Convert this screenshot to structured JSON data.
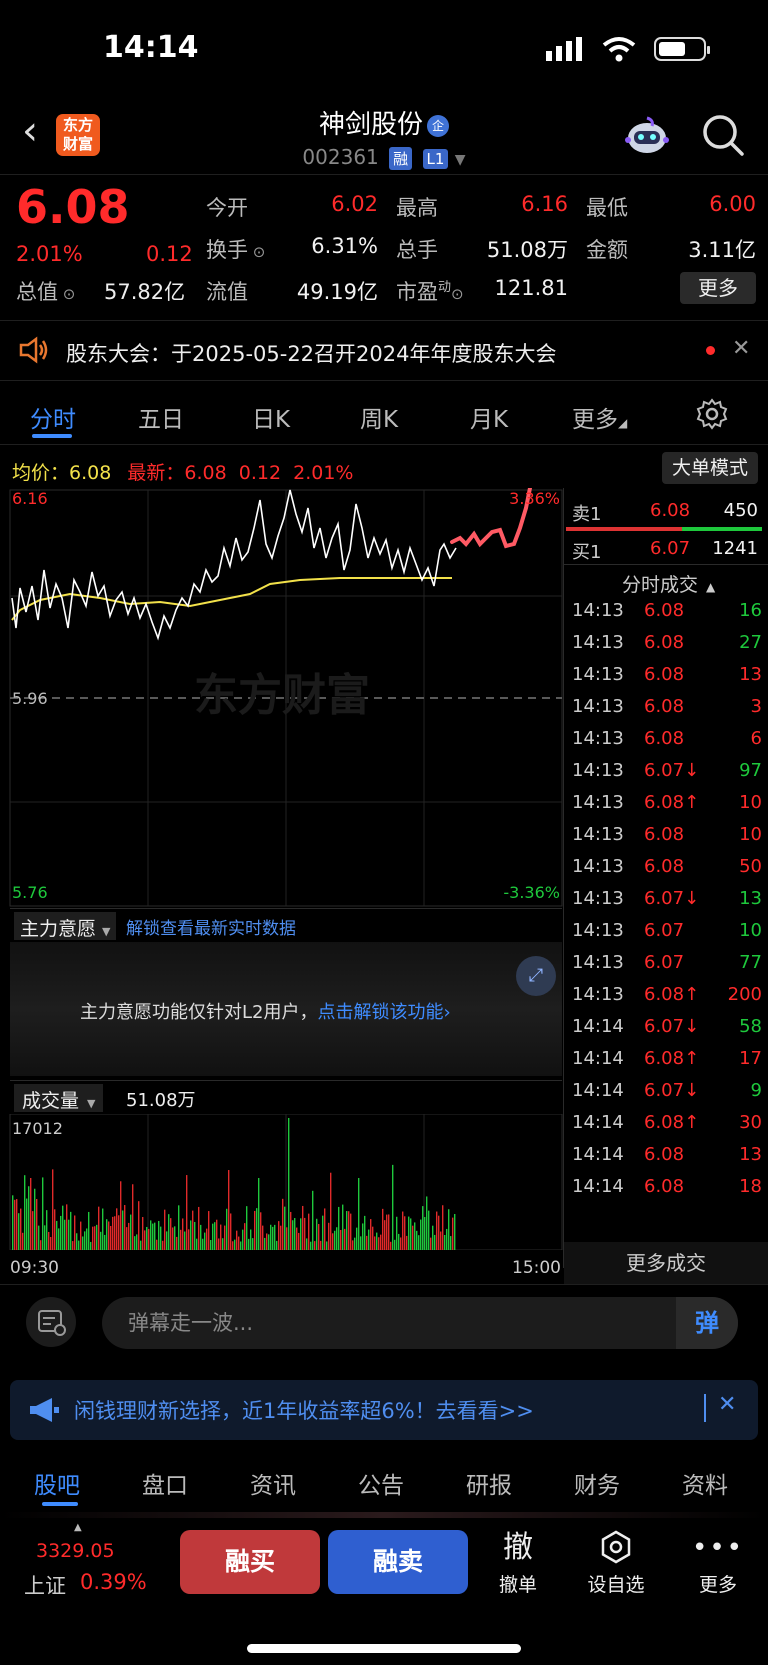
{
  "status_bar": {
    "time": "14:14"
  },
  "header": {
    "logo_line1": "东方",
    "logo_line2": "财富",
    "stock_name": "神剑股份",
    "cert_badge": "企",
    "stock_code": "002361",
    "tag1": "融",
    "tag2": "L1"
  },
  "quote": {
    "price": "6.08",
    "pct": "2.01%",
    "change": "0.12",
    "total_value_label": "总值",
    "total_value": "57.82亿",
    "open_label": "今开",
    "open": "6.02",
    "high_label": "最高",
    "high": "6.16",
    "low_label": "最低",
    "low": "6.00",
    "turnover_label": "换手",
    "turnover": "6.31%",
    "volume_label": "总手",
    "volume": "51.08万",
    "amount_label": "金额",
    "amount": "3.11亿",
    "float_label": "流值",
    "float_value": "49.19亿",
    "pe_label": "市盈",
    "pe_sup": "动",
    "pe": "121.81",
    "more_label": "更多"
  },
  "notice": {
    "text": "股东大会：于2025-05-22召开2024年年度股东大会"
  },
  "tabs": [
    "分时",
    "五日",
    "日K",
    "周K",
    "月K",
    "更多"
  ],
  "info_line": {
    "avg_label": "均价：",
    "avg": "6.08",
    "latest_label": "最新：",
    "latest": "6.08",
    "latest_change": "0.12",
    "latest_pct": "2.01%",
    "big_order_mode": "大单模式"
  },
  "chart_labels": {
    "top_price": "6.16",
    "mid_price": "5.96",
    "bottom_price": "5.76",
    "top_pct": "3.36%",
    "bottom_pct": "-3.36%",
    "watermark": "东方财富",
    "start_time": "09:30",
    "end_time": "15:00"
  },
  "main_force": {
    "label": "主力意愿",
    "unlock_link": "解锁查看最新实时数据",
    "message": "主力意愿功能仅针对L2用户，",
    "message_link": "点击解锁该功能"
  },
  "volume": {
    "label": "成交量",
    "total": "51.08万",
    "max": "17012"
  },
  "order_book": {
    "sell1_label": "卖1",
    "sell1_price": "6.08",
    "sell1_vol": "450",
    "buy1_label": "买1",
    "buy1_price": "6.07",
    "buy1_vol": "1241",
    "ticker_title": "分时成交",
    "more_trades": "更多成交"
  },
  "ticks": [
    {
      "time": "14:13",
      "price": "6.08",
      "arrow": "",
      "vol": "16",
      "side": "buy"
    },
    {
      "time": "14:13",
      "price": "6.08",
      "arrow": "",
      "vol": "27",
      "side": "buy"
    },
    {
      "time": "14:13",
      "price": "6.08",
      "arrow": "",
      "vol": "13",
      "side": "sell"
    },
    {
      "time": "14:13",
      "price": "6.08",
      "arrow": "",
      "vol": "3",
      "side": "sell"
    },
    {
      "time": "14:13",
      "price": "6.08",
      "arrow": "",
      "vol": "6",
      "side": "sell"
    },
    {
      "time": "14:13",
      "price": "6.07",
      "arrow": "↓",
      "vol": "97",
      "side": "buy"
    },
    {
      "time": "14:13",
      "price": "6.08",
      "arrow": "↑",
      "vol": "10",
      "side": "sell"
    },
    {
      "time": "14:13",
      "price": "6.08",
      "arrow": "",
      "vol": "10",
      "side": "sell"
    },
    {
      "time": "14:13",
      "price": "6.08",
      "arrow": "",
      "vol": "50",
      "side": "sell"
    },
    {
      "time": "14:13",
      "price": "6.07",
      "arrow": "↓",
      "vol": "13",
      "side": "buy"
    },
    {
      "time": "14:13",
      "price": "6.07",
      "arrow": "",
      "vol": "10",
      "side": "buy"
    },
    {
      "time": "14:13",
      "price": "6.07",
      "arrow": "",
      "vol": "77",
      "side": "buy"
    },
    {
      "time": "14:13",
      "price": "6.08",
      "arrow": "↑",
      "vol": "200",
      "side": "sell"
    },
    {
      "time": "14:14",
      "price": "6.07",
      "arrow": "↓",
      "vol": "58",
      "side": "buy"
    },
    {
      "time": "14:14",
      "price": "6.08",
      "arrow": "↑",
      "vol": "17",
      "side": "sell"
    },
    {
      "time": "14:14",
      "price": "6.07",
      "arrow": "↓",
      "vol": "9",
      "side": "buy"
    },
    {
      "time": "14:14",
      "price": "6.08",
      "arrow": "↑",
      "vol": "30",
      "side": "sell"
    },
    {
      "time": "14:14",
      "price": "6.08",
      "arrow": "",
      "vol": "13",
      "side": "sell"
    },
    {
      "time": "14:14",
      "price": "6.08",
      "arrow": "",
      "vol": "18",
      "side": "sell"
    }
  ],
  "danmu": {
    "placeholder": "弹幕走一波...",
    "send_label": "弹"
  },
  "ad": {
    "text": "闲钱理财新选择，近1年收益率超6%！去看看>>"
  },
  "bottom_tabs": [
    "股吧",
    "盘口",
    "资讯",
    "公告",
    "研报",
    "财务",
    "资料"
  ],
  "bottom_bar": {
    "index_value": "3329.05",
    "index_name": "上证",
    "index_pct": "0.39%",
    "buy_label": "融买",
    "sell_label": "融卖",
    "cancel_icon": "撤",
    "cancel_label": "撤单",
    "watchlist_label": "设自选",
    "more_label": "更多"
  },
  "colors": {
    "up": "#ff2b2b",
    "down": "#1ec83c",
    "accent": "#3f8cff",
    "avg_line": "#f2e14a"
  }
}
